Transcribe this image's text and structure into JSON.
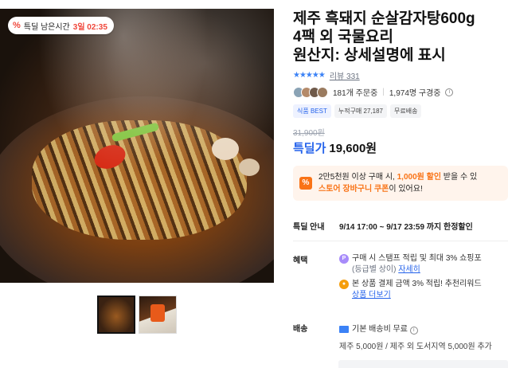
{
  "timer": {
    "label": "특딜 남은시간",
    "remaining": "3일 02:35",
    "icon": "percent-icon"
  },
  "product": {
    "title_lines": [
      "제주 흑돼지 순살감자탕600g",
      "4팩 외 국물요리",
      "원산지: 상세설명에 표시"
    ],
    "stars": "★★★★★",
    "review_link": "리뷰 331",
    "orders": "181개 주문중",
    "subscribers": "1,974명 구경중",
    "tags": [
      "식품 BEST",
      "누적구매 27,187",
      "무료배송"
    ],
    "original_price": "31,900원",
    "price_label": "특딜가",
    "price": "19,600원"
  },
  "coupon": {
    "icon": "%",
    "line1_prefix": "2만5천원 이상 구매 시, ",
    "line1_highlight": "1,000원 할인",
    "line1_suffix": " 받을 수 있",
    "line2_highlight": "스토어 장바구니 쿠폰",
    "line2_suffix": "이 있어요!"
  },
  "deal": {
    "label": "특딜 안내",
    "text": "9/14 17:00 ~ 9/17 23:59 까지 한정할인"
  },
  "benefit": {
    "label": "혜택",
    "line1": "구매 시 스탬프 적립 및 최대 3% 쇼핑포",
    "line1b": "(등급별 상이) ",
    "line1_link": "자세히",
    "line2": "본 상품 결제 금액 3% 적립! 추천리워드",
    "line2_link": "상품 더보기"
  },
  "shipping": {
    "label": "배송",
    "line1": "기본 배송비 무료",
    "line2": "제주 5,000원 / 제주 외 도서지역 5,000원 추가"
  },
  "colors": {
    "accent_blue": "#2563eb",
    "accent_orange": "#f97316",
    "badge_red": "#f0473b"
  }
}
